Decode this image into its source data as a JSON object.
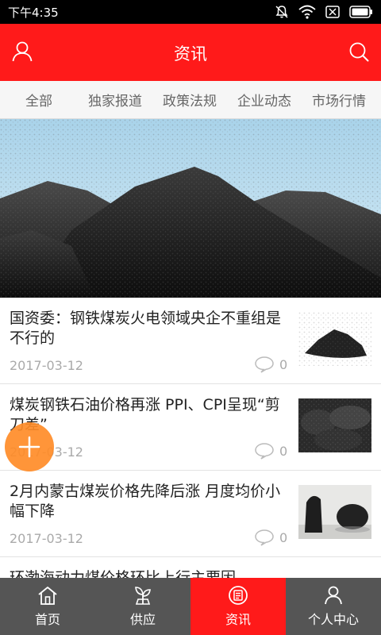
{
  "status_bar": {
    "time": "下午4:35"
  },
  "header": {
    "title": "资讯",
    "left_icon": "user-icon",
    "right_icon": "search-icon",
    "color": "#ff1a1a"
  },
  "tabs": [
    {
      "label": "全部"
    },
    {
      "label": "独家报道"
    },
    {
      "label": "政策法规"
    },
    {
      "label": "企业动态"
    },
    {
      "label": "市场行情"
    }
  ],
  "news": [
    {
      "title": "国资委：钢铁煤炭火电领域央企不重组是不行的",
      "date": "2017-03-12",
      "comments": "0"
    },
    {
      "title": "煤炭钢铁石油价格再涨 PPI、CPI呈现“剪刀差”",
      "date": "2017-03-12",
      "comments": "0"
    },
    {
      "title": "2月内蒙古煤炭价格先降后涨 月度均价小幅下降",
      "date": "2017-03-12",
      "comments": "0"
    },
    {
      "title": "环渤海动力煤价格环比上行主要因",
      "date": "",
      "comments": ""
    }
  ],
  "fab": {
    "icon": "plus-icon",
    "color": "#ff8c28"
  },
  "bottom_nav": [
    {
      "label": "首页",
      "icon": "home-icon"
    },
    {
      "label": "供应",
      "icon": "plant-icon"
    },
    {
      "label": "资讯",
      "icon": "news-icon",
      "active": true
    },
    {
      "label": "个人中心",
      "icon": "person-icon"
    }
  ]
}
